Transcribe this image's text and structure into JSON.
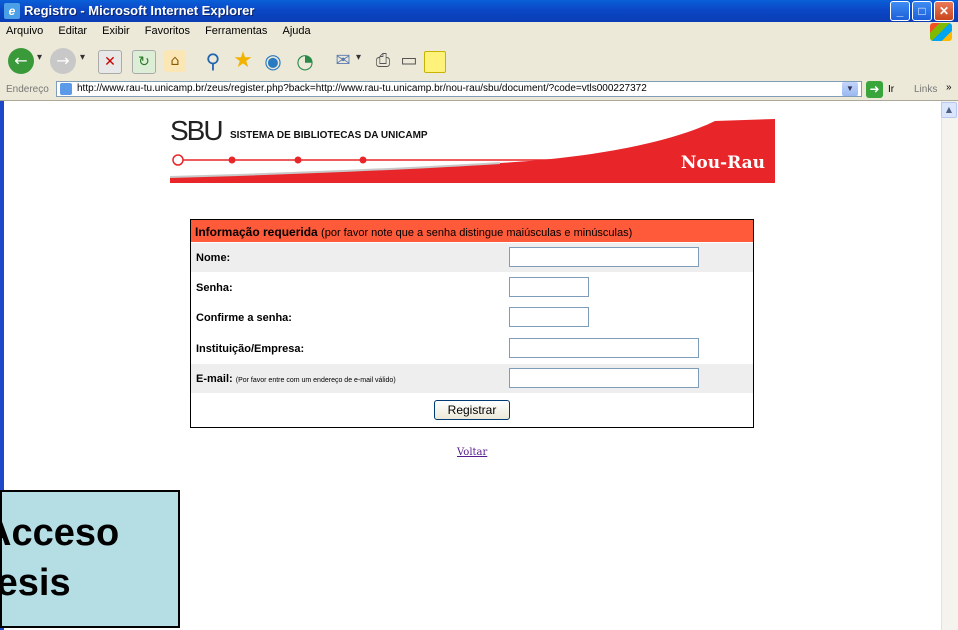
{
  "window": {
    "title": "Registro - Microsoft Internet Explorer"
  },
  "menu": [
    "Arquivo",
    "Editar",
    "Exibir",
    "Favoritos",
    "Ferramentas",
    "Ajuda"
  ],
  "address_bar": {
    "label": "Endereço",
    "url": "http://www.rau-tu.unicamp.br/zeus/register.php?back=http://www.rau-tu.unicamp.br/nou-rau/sbu/document/?code=vtls000227372",
    "go_label": "Ir",
    "links_label": "Links"
  },
  "banner": {
    "logo": "SBU",
    "subtitle": "SISTEMA DE BIBLIOTECAS DA UNICAMP",
    "brand": "Nou-Rau",
    "colors": {
      "accent": "#e8262a"
    }
  },
  "form": {
    "header_bold": "Informação requerida",
    "header_note": "(por favor note que a senha distingue maiúsculas e minúsculas)",
    "fields": {
      "nome": "Nome:",
      "senha": "Senha:",
      "confirme": "Confirme a senha:",
      "instituicao": "Instituição/Empresa:",
      "email": "E-mail:",
      "email_hint": "(Por favor entre com um endereço de e-mail válido)"
    },
    "values": {
      "nome": "",
      "senha": "",
      "confirme": "",
      "instituicao": "",
      "email": ""
    },
    "submit_label": "Registrar",
    "header_color": "#ff5a3a"
  },
  "back_link": "Voltar",
  "overlay": {
    "line1": "Acceso",
    "line2": "tesis"
  }
}
